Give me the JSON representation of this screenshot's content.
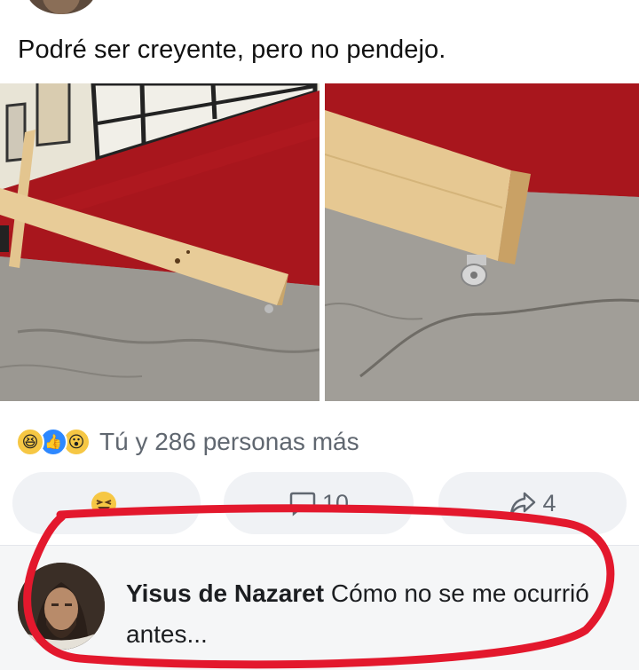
{
  "post": {
    "text": "Podré ser creyente, pero no pendejo."
  },
  "reactions": {
    "icons": [
      "haha-icon",
      "like-icon",
      "wow-icon"
    ],
    "summary": "Tú y 286 personas más"
  },
  "actions": {
    "comments_count": "10",
    "shares_count": "4"
  },
  "comment": {
    "author": "Yisus de Nazaret",
    "text": "Cómo no se me ocurrió antes..."
  },
  "colors": {
    "like": "#2d88ff",
    "haha": "#f6c744",
    "annotation": "#e3182d",
    "wall": "#a8161d"
  }
}
